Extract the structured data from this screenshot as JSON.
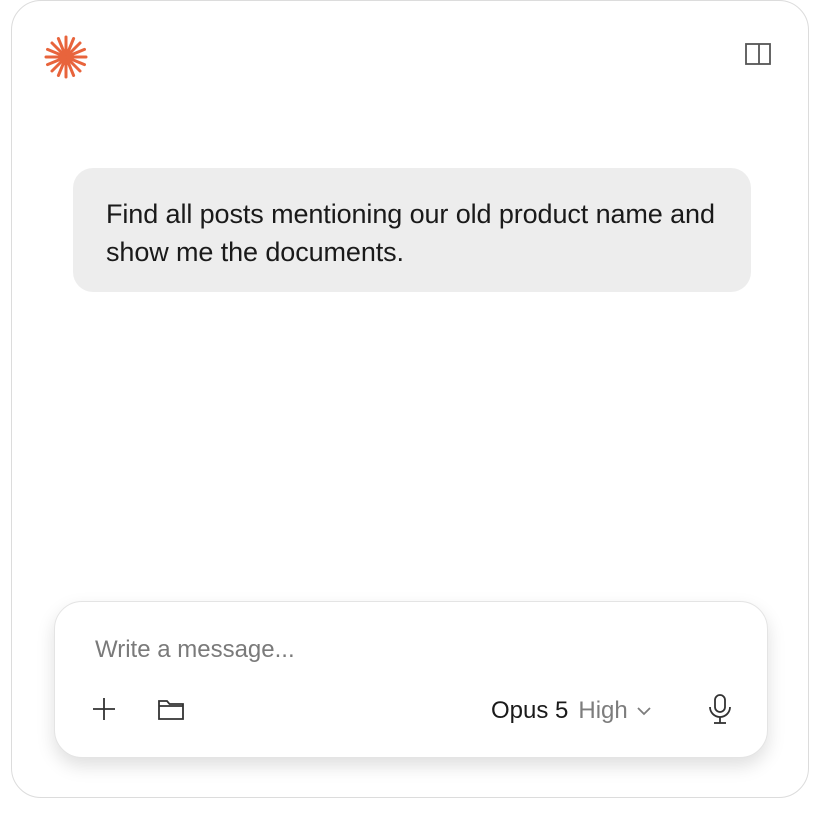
{
  "app": {
    "logo_icon": "asterisk-logo-icon",
    "accent_color": "#e8643c"
  },
  "header": {
    "sidebar_toggle_icon": "sidebar-panel-icon"
  },
  "conversation": {
    "messages": [
      {
        "role": "user",
        "text": "Find all posts mentioning our old product name and show me the documents."
      }
    ]
  },
  "composer": {
    "input_value": "",
    "placeholder": "Write a message...",
    "add_icon": "plus-icon",
    "folder_icon": "folder-icon",
    "model": {
      "name": "Opus 5",
      "effort": "High",
      "dropdown_icon": "chevron-down-icon"
    },
    "mic_icon": "microphone-icon"
  }
}
